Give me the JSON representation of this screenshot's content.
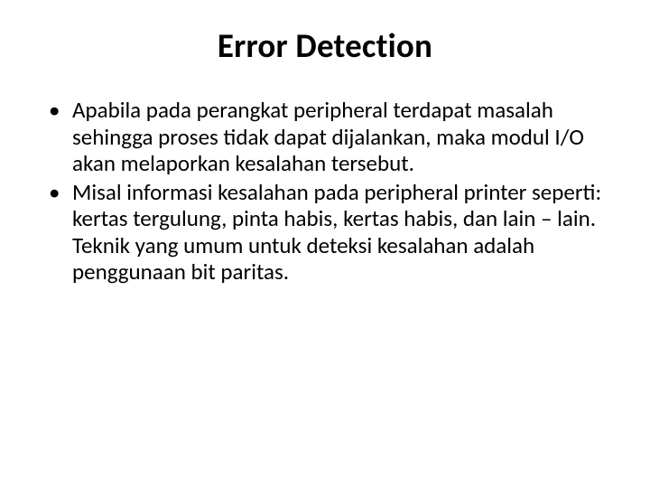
{
  "slide": {
    "title": "Error Detection",
    "bullets": [
      "Apabila pada perangkat peripheral terdapat masalah sehingga proses tidak dapat dijalankan, maka modul I/O akan melaporkan kesalahan tersebut.",
      "Misal informasi kesalahan pada peripheral printer seperti: kertas tergulung, pinta habis, kertas habis, dan lain – lain. Teknik yang umum untuk deteksi kesalahan adalah penggunaan bit paritas."
    ]
  }
}
